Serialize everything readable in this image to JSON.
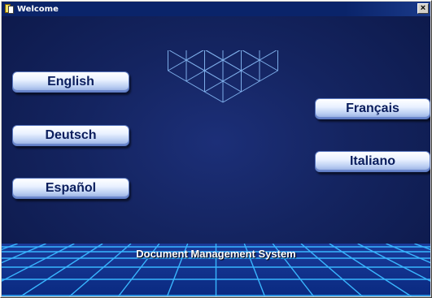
{
  "window": {
    "title": "Welcome",
    "close_glyph": "×"
  },
  "languages": {
    "english": "English",
    "deutsch": "Deutsch",
    "espanol": "Español",
    "francais": "Français",
    "italiano": "Italiano"
  },
  "product_name": "Document Management System",
  "colors": {
    "titlebar": "#0a246a",
    "background": "#142460",
    "grid": "#7fb8ff",
    "floor": "#2aa0ff"
  }
}
